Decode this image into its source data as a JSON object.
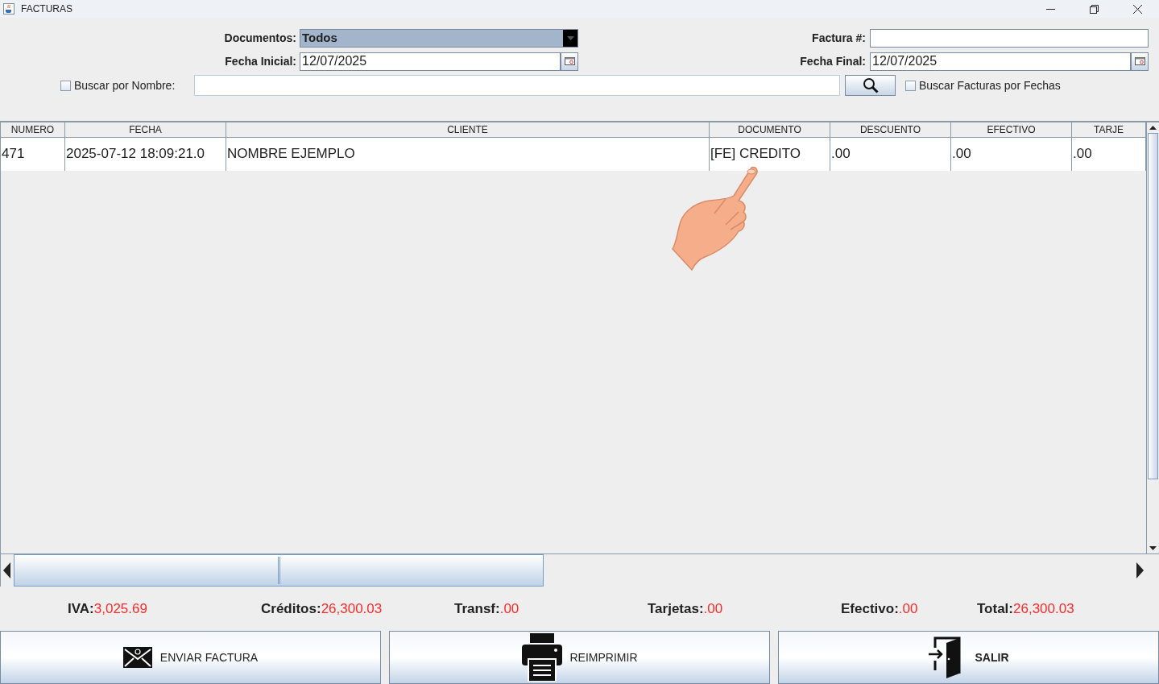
{
  "window": {
    "title": "FACTURAS"
  },
  "filters": {
    "documentos": {
      "label": "Documentos:",
      "value": "Todos"
    },
    "factura": {
      "label": "Factura #:"
    },
    "fecha_inicial": {
      "label": "Fecha Inicial:",
      "value": "12/07/2025"
    },
    "fecha_final": {
      "label": "Fecha Final:",
      "value": "12/07/2025"
    },
    "buscar_nombre": {
      "label": "Buscar por Nombre:",
      "checked": false
    },
    "buscar_fechas": {
      "label": "Buscar Facturas por Fechas",
      "checked": false
    }
  },
  "table": {
    "columns": [
      "NUMERO",
      "FECHA",
      "CLIENTE",
      "DOCUMENTO",
      "DESCUENTO",
      "EFECTIVO",
      "TARJE"
    ],
    "rows": [
      [
        "471",
        "2025-07-12 18:09:21.0",
        "NOMBRE EJEMPLO",
        "[FE] CREDITO",
        ".00",
        ".00",
        ".00"
      ]
    ]
  },
  "totals": [
    {
      "label": "IVA:",
      "value": "3,025.69"
    },
    {
      "label": "Créditos:",
      "value": "26,300.03"
    },
    {
      "label": "Transf:",
      "value": ".00"
    },
    {
      "label": "Tarjetas:",
      "value": ".00"
    },
    {
      "label": "Efectivo:",
      "value": ".00"
    },
    {
      "label": "Total:",
      "value": "26,300.03"
    }
  ],
  "buttons": [
    {
      "kind": "mail",
      "label": "ENVIAR FACTURA"
    },
    {
      "kind": "print",
      "label": "REIMPRIMIR"
    },
    {
      "kind": "exit",
      "label": "SALIR"
    }
  ]
}
